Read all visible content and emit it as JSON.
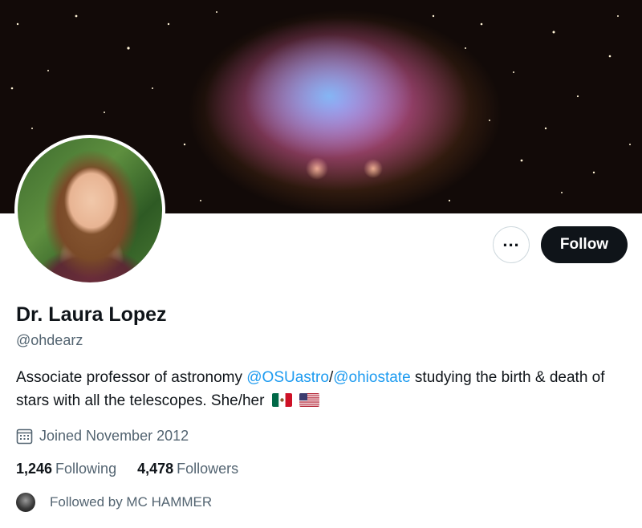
{
  "profile": {
    "name": "Dr. Laura Lopez",
    "handle": "@ohdearz",
    "bio": {
      "prefix": "Associate professor of astronomy ",
      "mention1": "@OSUastro",
      "separator": "/",
      "mention2": "@ohiostate",
      "suffix": " studying the birth & death of stars with all the telescopes. She/her",
      "flags": [
        "mexico-flag-icon",
        "usa-flag-icon"
      ]
    },
    "joined": "Joined November 2012",
    "stats": {
      "following_count": "1,246",
      "following_label": "Following",
      "followers_count": "4,478",
      "followers_label": "Followers"
    },
    "followed_by": "Followed by MC HAMMER"
  },
  "actions": {
    "more_label": "...",
    "follow_label": "Follow"
  },
  "icons": {
    "more": "more-options-icon",
    "calendar": "calendar-icon"
  },
  "colors": {
    "accent": "#1d9bf0",
    "text_primary": "#0f1419",
    "text_secondary": "#536471",
    "button_dark": "#0f1419",
    "border": "#cfd9de"
  }
}
